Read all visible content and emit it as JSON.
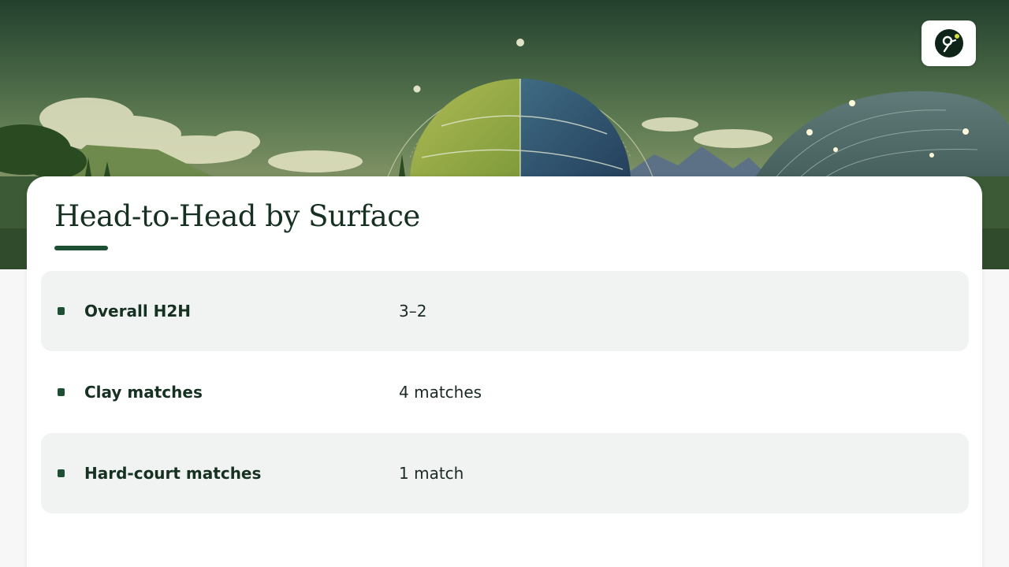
{
  "header": {
    "logo_icon": "tennis-player-icon",
    "accent_color": "#1d4f35",
    "logo_ball_color": "#d5e03a"
  },
  "card": {
    "title": "Head-to-Head by Surface"
  },
  "rows": [
    {
      "label": "Overall H2H",
      "value": "3–2"
    },
    {
      "label": "Clay matches",
      "value": "4 matches"
    },
    {
      "label": "Hard-court matches",
      "value": "1 match"
    }
  ]
}
